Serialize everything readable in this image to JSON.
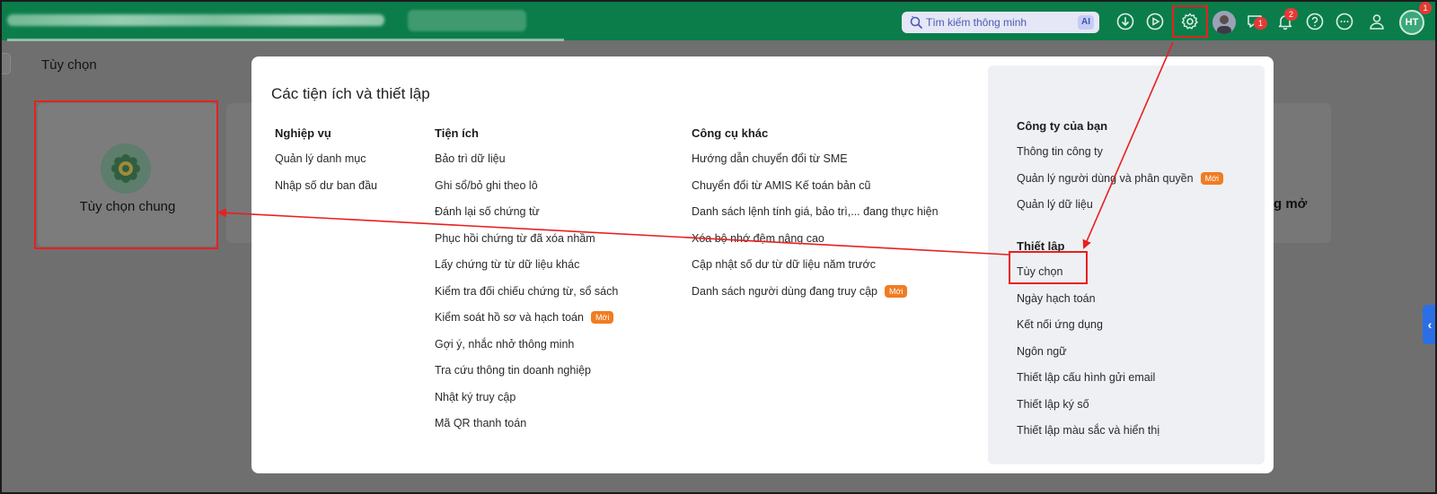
{
  "topbar": {
    "search_placeholder": "Tìm kiếm thông minh",
    "ai_badge": "AI",
    "chat_count": "1",
    "notification_count": "2",
    "corner_count": "1",
    "avatar_initials": "HT",
    "color": "#0b7d4a"
  },
  "page": {
    "title": "Tùy chọn",
    "card_general_label": "Tùy chọn chung",
    "card_right_label": "g mở"
  },
  "modal": {
    "title": "Các tiện ích và thiết lập",
    "columns": [
      {
        "header": "Nghiệp vụ",
        "items": [
          {
            "label": "Quản lý danh mục",
            "new": ""
          },
          {
            "label": "Nhập số dư ban đầu",
            "new": ""
          }
        ]
      },
      {
        "header": "Tiện ích",
        "items": [
          {
            "label": "Bảo trì dữ liệu",
            "new": ""
          },
          {
            "label": "Ghi sổ/bỏ ghi theo lô",
            "new": ""
          },
          {
            "label": "Đánh lại số chứng từ",
            "new": ""
          },
          {
            "label": "Phục hồi chứng từ đã xóa nhầm",
            "new": ""
          },
          {
            "label": "Lấy chứng từ từ dữ liệu khác",
            "new": ""
          },
          {
            "label": "Kiểm tra đối chiếu chứng từ, sổ sách",
            "new": ""
          },
          {
            "label": "Kiểm soát hồ sơ và hạch toán",
            "new": "Mới"
          },
          {
            "label": "Gợi ý, nhắc nhở thông minh",
            "new": ""
          },
          {
            "label": "Tra cứu thông tin doanh nghiệp",
            "new": ""
          },
          {
            "label": "Nhật ký truy cập",
            "new": ""
          },
          {
            "label": "Mã QR thanh toán",
            "new": ""
          }
        ]
      },
      {
        "header": "Công cụ khác",
        "items": [
          {
            "label": "Hướng dẫn chuyển đổi từ SME",
            "new": ""
          },
          {
            "label": "Chuyển đổi từ AMIS Kế toán bản cũ",
            "new": ""
          },
          {
            "label": "Danh sách lệnh tính giá, bảo trì,... đang thực hiện",
            "new": ""
          },
          {
            "label": "Xóa bộ nhớ đệm nâng cao",
            "new": ""
          },
          {
            "label": "Cập nhật số dư từ dữ liệu năm trước",
            "new": ""
          },
          {
            "label": "Danh sách người dùng đang truy cập",
            "new": "Mới"
          }
        ]
      }
    ],
    "company": {
      "header": "Công ty của bạn",
      "items": [
        {
          "label": "Thông tin công ty",
          "new": ""
        },
        {
          "label": "Quản lý người dùng và phân quyền",
          "new": "Mới"
        },
        {
          "label": "Quản lý dữ liệu",
          "new": ""
        }
      ]
    },
    "setup": {
      "header": "Thiết lập",
      "items": [
        {
          "label": "Tùy chọn",
          "new": ""
        },
        {
          "label": "Ngày hạch toán",
          "new": ""
        },
        {
          "label": "Kết nối ứng dụng",
          "new": ""
        },
        {
          "label": "Ngôn ngữ",
          "new": ""
        },
        {
          "label": "Thiết lập cấu hình gửi email",
          "new": ""
        },
        {
          "label": "Thiết lập ký số",
          "new": ""
        },
        {
          "label": "Thiết lập màu sắc và hiển thị",
          "new": ""
        }
      ]
    }
  },
  "colors": {
    "annotation": "#e8201e",
    "new_badge": "#f07c22",
    "side_tab": "#2b6fe6"
  }
}
